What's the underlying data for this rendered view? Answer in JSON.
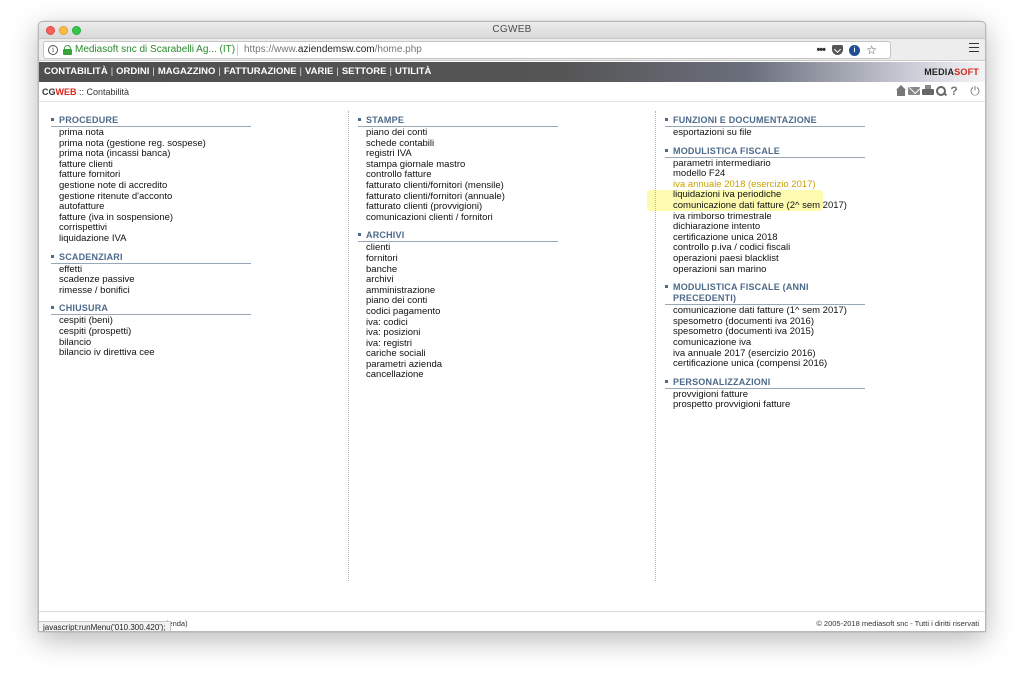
{
  "window": {
    "title": "CGWEB"
  },
  "urlbar": {
    "site_identity": "Mediasoft snc di Scarabelli Ag... (IT)",
    "url_prefix": "https://www.",
    "url_domain": "aziendemsw.com",
    "url_path": "/home.php"
  },
  "nav": {
    "menu": [
      "CONTABILITÀ",
      "ORDINI",
      "MAGAZZINO",
      "FATTURAZIONE",
      "VARIE",
      "SETTORE",
      "UTILITÀ"
    ],
    "brand_part1": "MEDIA",
    "brand_part2": "SOFT"
  },
  "breadcrumb": {
    "app_cg": "CG",
    "app_web": "WEB",
    "sep": " :: ",
    "current": "Contabilità"
  },
  "columns": [
    {
      "sections": [
        {
          "title": "PROCEDURE",
          "items": [
            "prima nota",
            "prima nota (gestione reg. sospese)",
            "prima nota (incassi banca)",
            "fatture clienti",
            "fatture fornitori",
            "gestione note di accredito",
            "gestione ritenute d'acconto",
            "autofatture",
            "fatture (iva in sospensione)",
            "corrispettivi",
            "liquidazione IVA"
          ]
        },
        {
          "title": "SCADENZIARI",
          "items": [
            "effetti",
            "scadenze passive",
            "rimesse / bonifici"
          ]
        },
        {
          "title": "CHIUSURA",
          "items": [
            "cespiti (beni)",
            "cespiti (prospetti)",
            "bilancio",
            "bilancio iv direttiva cee"
          ]
        }
      ]
    },
    {
      "sections": [
        {
          "title": "STAMPE",
          "items": [
            "piano dei conti",
            "schede contabili",
            "registri IVA",
            "stampa giornale mastro",
            "controllo fatture",
            "fatturato clienti/fornitori (mensile)",
            "fatturato clienti/fornitori (annuale)",
            "fatturato clienti (provvigioni)",
            "comunicazioni clienti / fornitori"
          ]
        },
        {
          "title": "ARCHIVI",
          "items": [
            "clienti",
            "fornitori",
            "banche",
            "archivi",
            "amministrazione",
            "piano dei conti",
            "codici pagamento",
            "iva: codici",
            "iva: posizioni",
            "iva: registri",
            "cariche sociali",
            "parametri azienda",
            "cancellazione"
          ]
        }
      ]
    },
    {
      "sections": [
        {
          "title": "FUNZIONI E DOCUMENTAZIONE",
          "items": [
            "esportazioni su file"
          ]
        },
        {
          "title": "MODULISTICA FISCALE",
          "items": [
            "parametri intermediario",
            "modello F24",
            "iva annuale 2018 (esercizio 2017)",
            "liquidazioni iva periodiche",
            "comunicazione dati fatture (2^ sem 2017)",
            "iva rimborso trimestrale",
            "dichiarazione intento",
            "certificazione unica 2018",
            "controllo p.iva / codici fiscali",
            "operazioni paesi blacklist",
            "operazioni san marino"
          ]
        },
        {
          "title": "MODULISTICA FISCALE (ANNI PRECEDENTI)",
          "items": [
            "comunicazione dati fatture (1^ sem 2017)",
            "spesometro (documenti iva 2016)",
            "spesometro (documenti iva 2015)",
            "comunicazione iva",
            "iva annuale 2017 (esercizio 2016)",
            "certificazione unica (compensi 2016)"
          ]
        },
        {
          "title": "PERSONALIZZAZIONI",
          "items": [
            "provvigioni fatture",
            "prospetto provvigioni fatture"
          ]
        }
      ]
    }
  ],
  "highlighted_item": "iva annuale 2018 (esercizio 2017)",
  "footer": {
    "left": "zienda)",
    "right": "© 2005-2018 mediasoft snc - Tutti i diritti riservati",
    "status": "javascript:runMenu('010.300.420');"
  }
}
